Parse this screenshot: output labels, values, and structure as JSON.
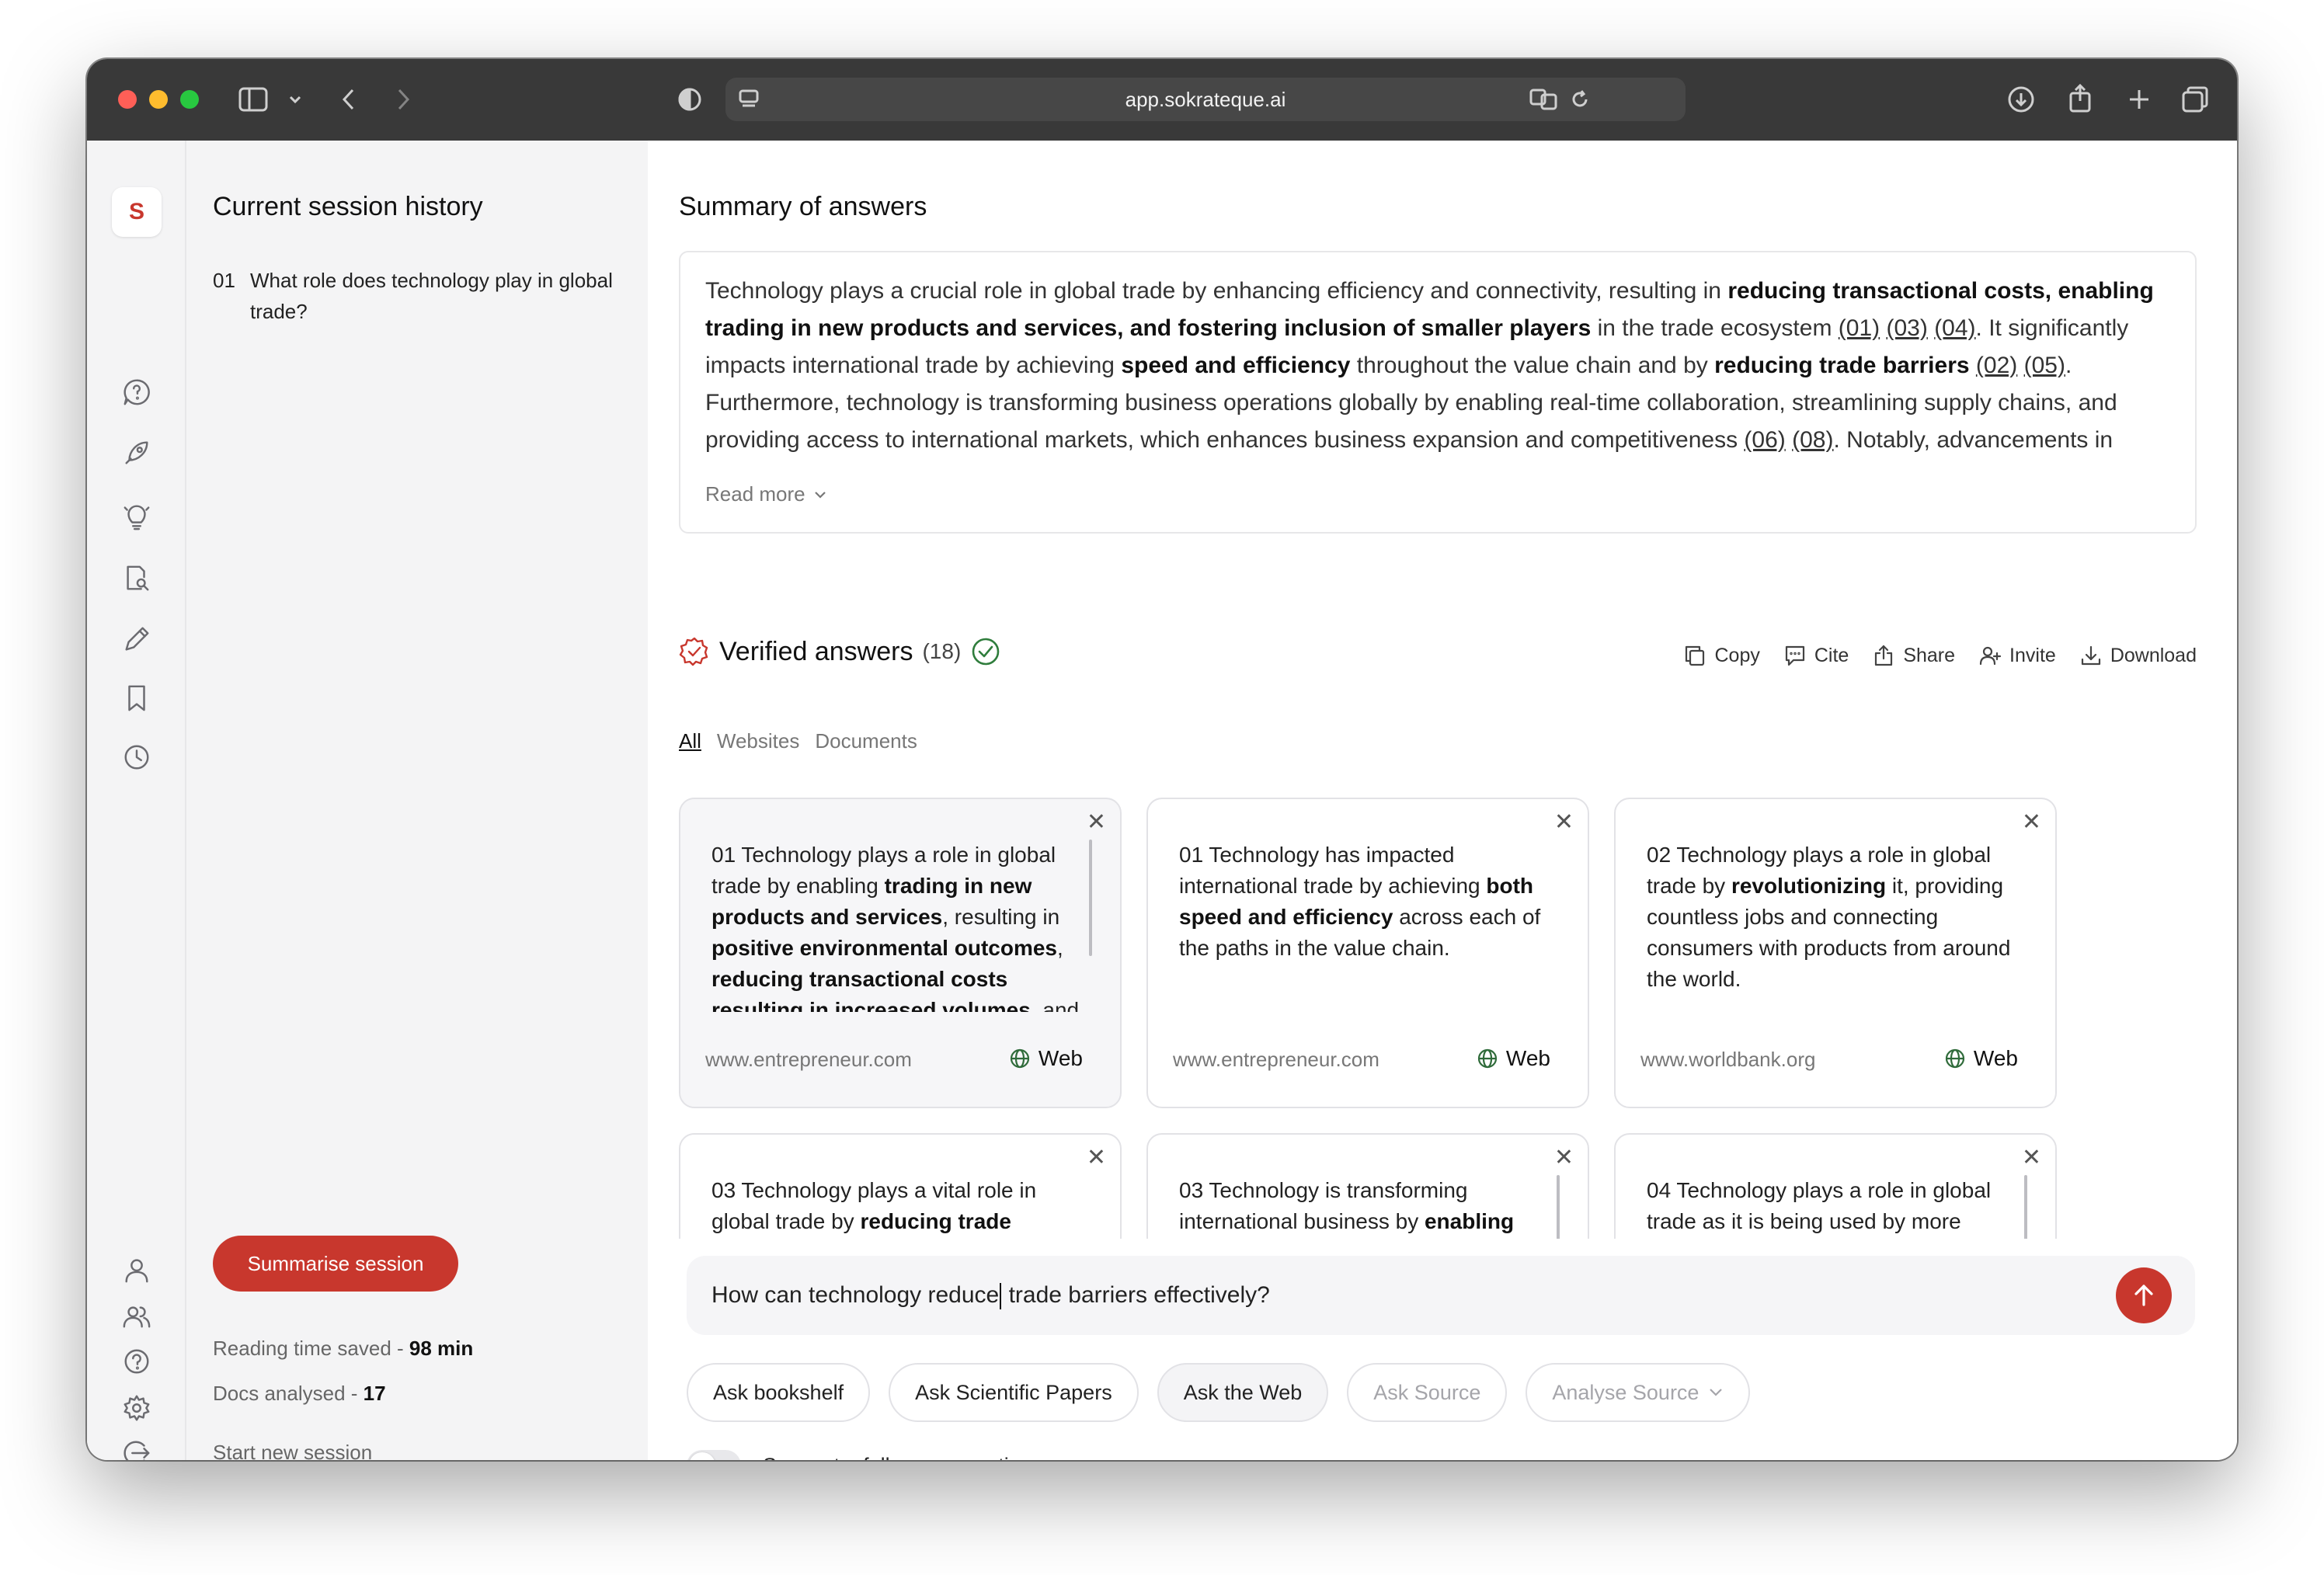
{
  "browser": {
    "url": "app.sokrateque.ai"
  },
  "app": {
    "logo_letter": "S",
    "brand_color": "#c8372d"
  },
  "history": {
    "title": "Current session history",
    "items": [
      {
        "num": "01",
        "text": "What role does technology play in global trade?"
      }
    ],
    "summarise_label": "Summarise session",
    "reading_time_label": "Reading time saved - ",
    "reading_time_value": "98 min",
    "docs_label": "Docs analysed - ",
    "docs_value": "17",
    "start_new_label": "Start new session"
  },
  "summary": {
    "title": "Summary of answers",
    "p1": "Technology plays a crucial role in global trade by enhancing efficiency and connectivity, resulting in ",
    "b1": "reducing transactional costs, enabling trading in new products and services, and fostering inclusion of smaller players",
    "p2": " in the trade ecosystem ",
    "r1": "(01)",
    "r2": "(03)",
    "r3": "(04)",
    "p3": ". It significantly impacts international trade by achieving ",
    "b2": "speed and efficiency",
    "p4": " throughout the value chain and by ",
    "b3": "reducing trade barriers",
    "p5": " ",
    "r4": "(02)",
    "r5": "(05)",
    "p6": ". Furthermore, technology is transforming business operations globally by enabling real-time collaboration, streamlining supply chains, and providing access to international markets, which enhances business expansion and competitiveness ",
    "r6": "(06)",
    "r7": "(08)",
    "p7": ". Notably, advancements in technologies such as",
    "read_more": "Read more"
  },
  "verified": {
    "title": "Verified answers",
    "count": "(18)",
    "actions": {
      "copy": "Copy",
      "cite": "Cite",
      "share": "Share",
      "invite": "Invite",
      "download": "Download"
    },
    "filters": {
      "all": "All",
      "websites": "Websites",
      "documents": "Documents"
    }
  },
  "cards": [
    {
      "pre": "01 Technology plays a role in global trade by enabling ",
      "b1": "trading in new products and services",
      "mid": ", resulting in ",
      "b2": "positive environmental outcomes",
      "mid2": ", ",
      "b3": "reducing transactional costs resulting in increased volumes",
      "post": ", and",
      "source": "www.entrepreneur.com",
      "type": "Web"
    },
    {
      "pre": "01 Technology has impacted international trade by achieving ",
      "b1": "both speed and efficiency",
      "post": " across each of the paths in the value chain.",
      "source": "www.entrepreneur.com",
      "type": "Web"
    },
    {
      "pre": "02 Technology plays a role in global trade by ",
      "b1": "revolutionizing",
      "post": " it, providing countless jobs and connecting consumers with products from around the world.",
      "source": "www.worldbank.org",
      "type": "Web"
    },
    {
      "pre": "03 Technology plays a vital role in global trade by ",
      "b1": "reducing trade"
    },
    {
      "pre": "03 Technology is transforming international business by ",
      "b1": "enabling"
    },
    {
      "pre": "04 Technology plays a role in global trade as it is being used by more"
    }
  ],
  "composer": {
    "query_before_caret": "How can technology reduce",
    "query_after_caret": " trade barriers effectively?",
    "pills": {
      "bookshelf": "Ask bookshelf",
      "papers": "Ask Scientific Papers",
      "web": "Ask the Web",
      "source": "Ask Source",
      "analyse": "Analyse Source"
    },
    "follow_up_label": "Suggest a follow-up question"
  }
}
